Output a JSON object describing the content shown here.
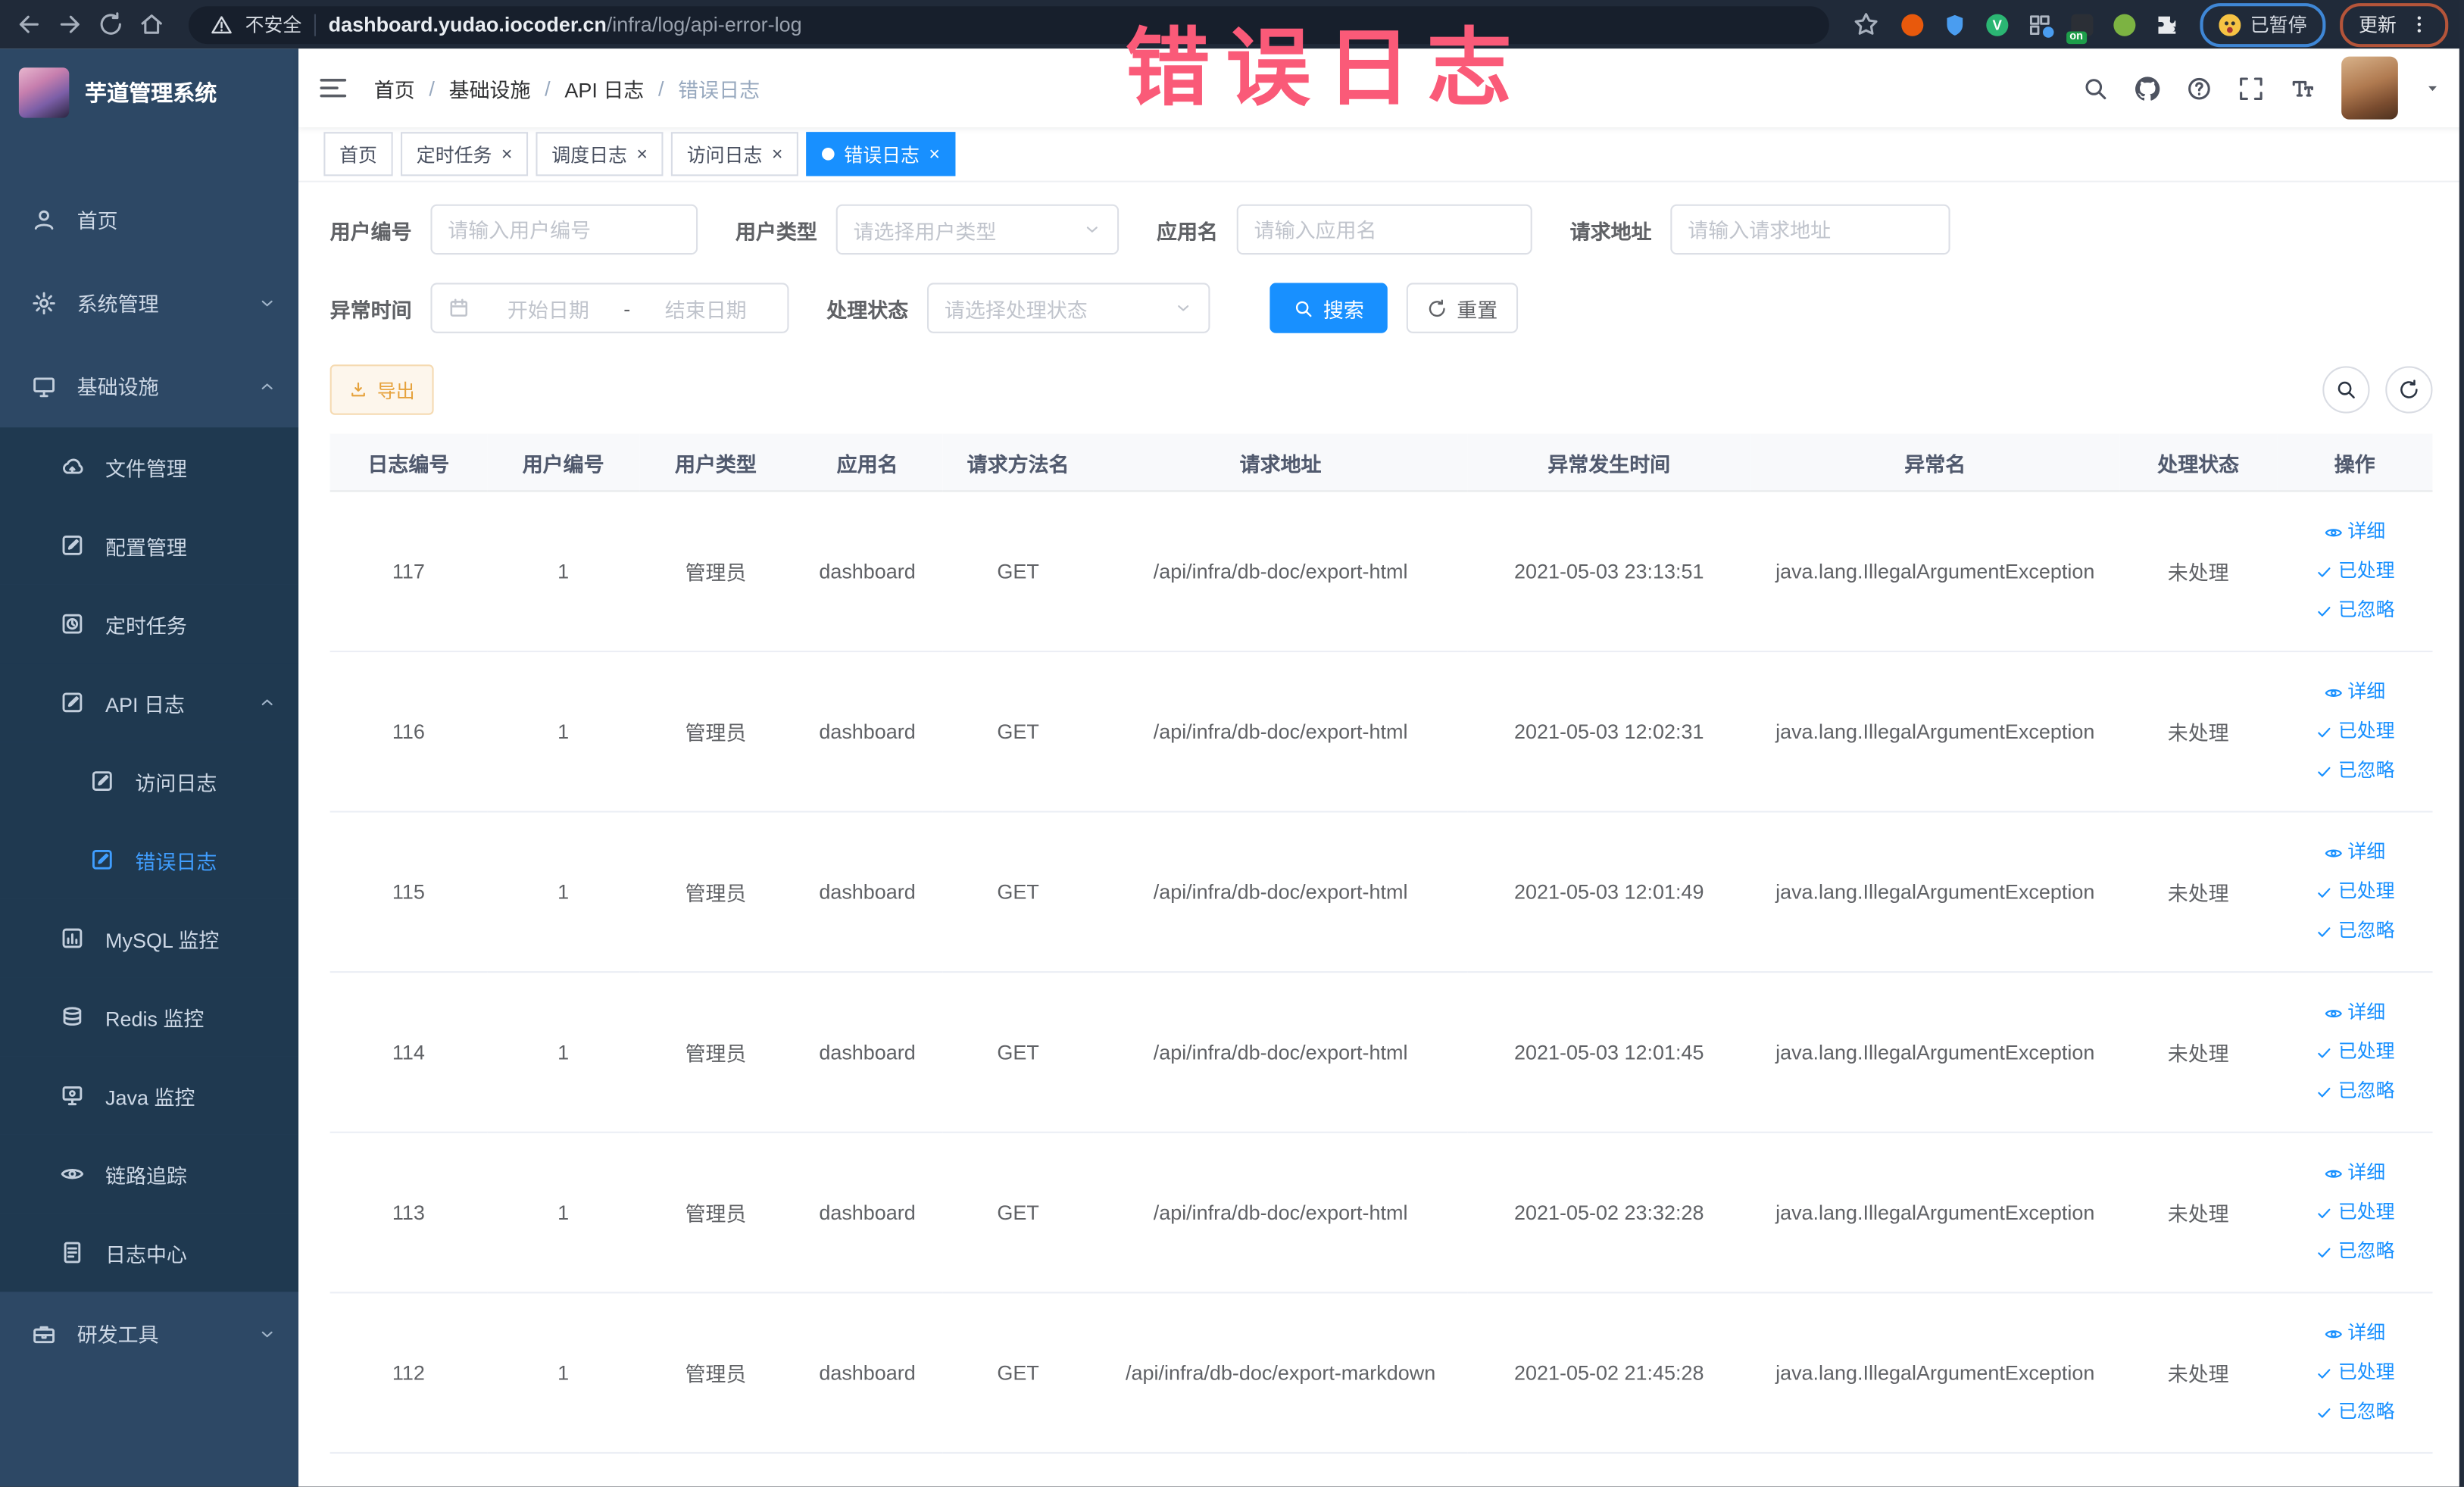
{
  "browser": {
    "security_label": "不安全",
    "url_domain": "dashboard.yudao.iocoder.cn",
    "url_path": "/infra/log/api-error-log",
    "paused_label": "已暂停",
    "update_label": "更新",
    "extensions": [
      {
        "name": "extension-orange-icon",
        "shape": "circle",
        "color": "#e8590c"
      },
      {
        "name": "extension-shield-icon",
        "shape": "shield",
        "color": "#4a9df0"
      },
      {
        "name": "extension-v-icon",
        "shape": "circle-v",
        "color": "#2bb673",
        "letter": "V"
      },
      {
        "name": "extension-grid-icon",
        "shape": "grid",
        "color": "#aeb6c2"
      },
      {
        "name": "extension-on-icon",
        "shape": "badge-on",
        "color": "#2b2f36",
        "badge": "on"
      },
      {
        "name": "extension-leaf-icon",
        "shape": "circle",
        "color": "#7cb342"
      },
      {
        "name": "extension-puzzle-icon",
        "shape": "puzzle",
        "color": "#e8eaed"
      }
    ]
  },
  "annotation": {
    "text": "错误日志",
    "color": "#fa5a78"
  },
  "sidebar": {
    "title": "芋道管理系统",
    "items": [
      {
        "name": "home",
        "label": "首页",
        "icon": "people-icon",
        "level": 1
      },
      {
        "name": "system-management",
        "label": "系统管理",
        "icon": "gear-icon",
        "level": 1,
        "chevron": "down"
      },
      {
        "name": "infrastructure",
        "label": "基础设施",
        "icon": "monitor-icon",
        "level": 1,
        "chevron": "up"
      },
      {
        "name": "file-management",
        "label": "文件管理",
        "icon": "cloud-upload-icon",
        "level": 2,
        "group": true
      },
      {
        "name": "config-management",
        "label": "配置管理",
        "icon": "edit-icon",
        "level": 2,
        "group": true
      },
      {
        "name": "scheduled-tasks",
        "label": "定时任务",
        "icon": "clock-icon",
        "level": 2,
        "group": true
      },
      {
        "name": "api-log",
        "label": "API 日志",
        "icon": "edit-icon",
        "level": 2,
        "group": true,
        "chevron": "up"
      },
      {
        "name": "access-log",
        "label": "访问日志",
        "icon": "edit-icon",
        "level": 3,
        "group": true
      },
      {
        "name": "error-log",
        "label": "错误日志",
        "icon": "edit-icon",
        "level": 3,
        "group": true,
        "active": true
      },
      {
        "name": "mysql-monitor",
        "label": "MySQL 监控",
        "icon": "chart-icon",
        "level": 2,
        "group": true
      },
      {
        "name": "redis-monitor",
        "label": "Redis 监控",
        "icon": "stack-icon",
        "level": 2,
        "group": true
      },
      {
        "name": "java-monitor",
        "label": "Java 监控",
        "icon": "java-icon",
        "level": 2,
        "group": true
      },
      {
        "name": "trace",
        "label": "链路追踪",
        "icon": "eye-icon",
        "level": 2,
        "group": true
      },
      {
        "name": "log-center",
        "label": "日志中心",
        "icon": "doc-icon",
        "level": 2,
        "group": true
      },
      {
        "name": "dev-tools",
        "label": "研发工具",
        "icon": "toolbox-icon",
        "level": 1,
        "chevron": "down"
      }
    ]
  },
  "header": {
    "breadcrumb": [
      "首页",
      "基础设施",
      "API 日志",
      "错误日志"
    ]
  },
  "tabs": [
    {
      "name": "tab-home",
      "label": "首页",
      "closable": false,
      "active": false
    },
    {
      "name": "tab-scheduled-tasks",
      "label": "定时任务",
      "closable": true,
      "active": false
    },
    {
      "name": "tab-schedule-log",
      "label": "调度日志",
      "closable": true,
      "active": false
    },
    {
      "name": "tab-access-log",
      "label": "访问日志",
      "closable": true,
      "active": false
    },
    {
      "name": "tab-error-log",
      "label": "错误日志",
      "closable": true,
      "active": true
    }
  ],
  "filters": {
    "user_id": {
      "label": "用户编号",
      "placeholder": "请输入用户编号"
    },
    "user_type": {
      "label": "用户类型",
      "placeholder": "请选择用户类型"
    },
    "app_name": {
      "label": "应用名",
      "placeholder": "请输入应用名"
    },
    "request_url": {
      "label": "请求地址",
      "placeholder": "请输入请求地址"
    },
    "exception_time": {
      "label": "异常时间",
      "start_placeholder": "开始日期",
      "separator": "-",
      "end_placeholder": "结束日期"
    },
    "handle_status": {
      "label": "处理状态",
      "placeholder": "请选择处理状态"
    },
    "search_label": "搜索",
    "reset_label": "重置"
  },
  "toolbar": {
    "export_label": "导出"
  },
  "table": {
    "columns": [
      "日志编号",
      "用户编号",
      "用户类型",
      "应用名",
      "请求方法名",
      "请求地址",
      "异常发生时间",
      "异常名",
      "处理状态",
      "操作"
    ],
    "actions": [
      {
        "name": "detail-link",
        "label": "详细",
        "icon": "eye-icon"
      },
      {
        "name": "mark-processed-link",
        "label": "已处理",
        "icon": "check-icon"
      },
      {
        "name": "mark-ignored-link",
        "label": "已忽略",
        "icon": "check-icon"
      }
    ],
    "rows": [
      {
        "id": "117",
        "user_id": "1",
        "user_type": "管理员",
        "app": "dashboard",
        "method": "GET",
        "url": "/api/infra/db-doc/export-html",
        "time": "2021-05-03 23:13:51",
        "exception": "java.lang.IllegalArgumentException",
        "status": "未处理"
      },
      {
        "id": "116",
        "user_id": "1",
        "user_type": "管理员",
        "app": "dashboard",
        "method": "GET",
        "url": "/api/infra/db-doc/export-html",
        "time": "2021-05-03 12:02:31",
        "exception": "java.lang.IllegalArgumentException",
        "status": "未处理"
      },
      {
        "id": "115",
        "user_id": "1",
        "user_type": "管理员",
        "app": "dashboard",
        "method": "GET",
        "url": "/api/infra/db-doc/export-html",
        "time": "2021-05-03 12:01:49",
        "exception": "java.lang.IllegalArgumentException",
        "status": "未处理"
      },
      {
        "id": "114",
        "user_id": "1",
        "user_type": "管理员",
        "app": "dashboard",
        "method": "GET",
        "url": "/api/infra/db-doc/export-html",
        "time": "2021-05-03 12:01:45",
        "exception": "java.lang.IllegalArgumentException",
        "status": "未处理"
      },
      {
        "id": "113",
        "user_id": "1",
        "user_type": "管理员",
        "app": "dashboard",
        "method": "GET",
        "url": "/api/infra/db-doc/export-html",
        "time": "2021-05-02 23:32:28",
        "exception": "java.lang.IllegalArgumentException",
        "status": "未处理"
      },
      {
        "id": "112",
        "user_id": "1",
        "user_type": "管理员",
        "app": "dashboard",
        "method": "GET",
        "url": "/api/infra/db-doc/export-markdown",
        "time": "2021-05-02 21:45:28",
        "exception": "java.lang.IllegalArgumentException",
        "status": "未处理"
      }
    ]
  }
}
